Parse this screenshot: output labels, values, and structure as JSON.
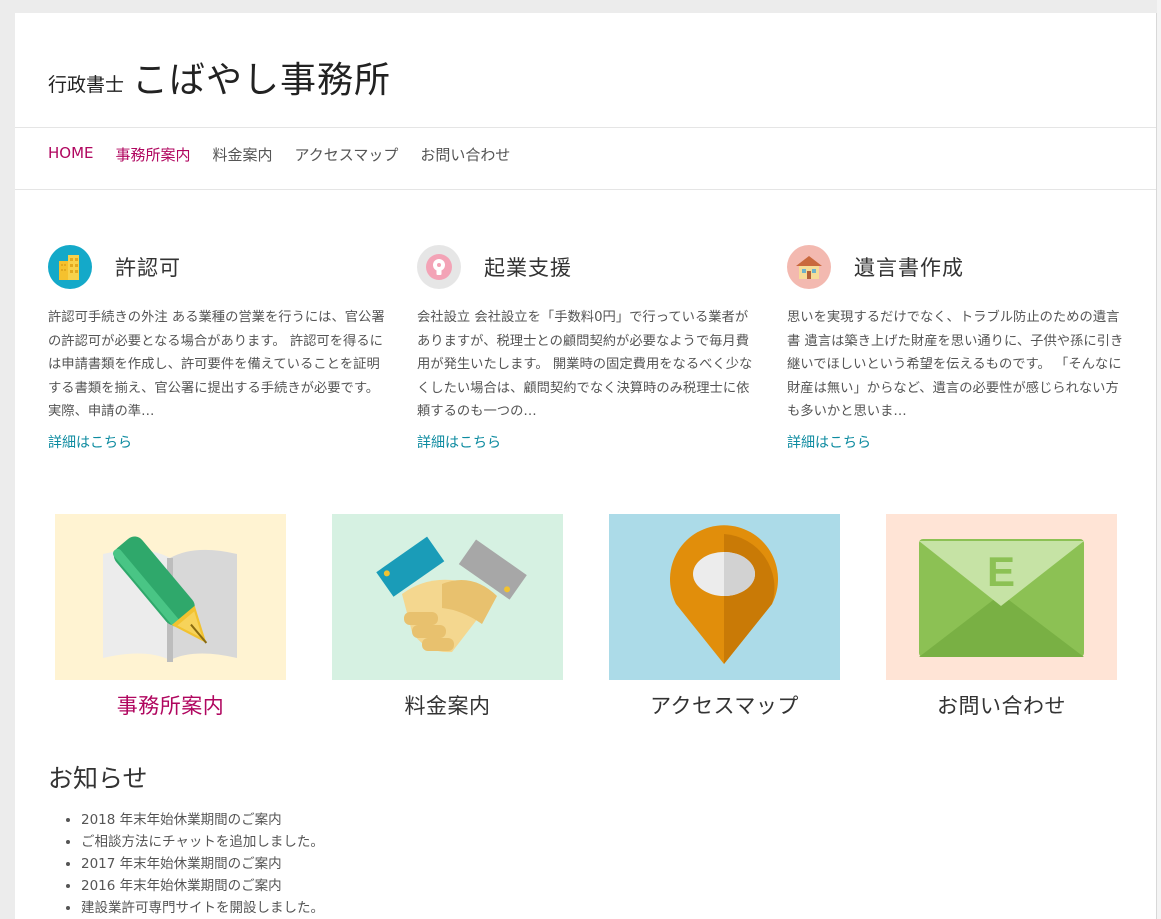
{
  "header": {
    "title_prefix": "行政書士",
    "title_main": "こばやし事務所"
  },
  "nav": [
    {
      "label": "HOME",
      "active": true
    },
    {
      "label": "事務所案内",
      "active": true
    },
    {
      "label": "料金案内",
      "active": false
    },
    {
      "label": "アクセスマップ",
      "active": false
    },
    {
      "label": "お問い合わせ",
      "active": false
    }
  ],
  "features": [
    {
      "icon": "building-icon",
      "title": "許認可",
      "text": "許認可手続きの外注 ある業種の営業を行うには、官公署の許認可が必要となる場合があります。 許認可を得るには申請書類を作成し、許可要件を備えていることを証明する書類を揃え、官公署に提出する手続きが必要です。 実際、申請の準…",
      "link": "詳細はこちら"
    },
    {
      "icon": "lightbulb-icon",
      "title": "起業支援",
      "text": "会社設立 会社設立を「手数料0円」で行っている業者がありますが、税理士との顧問契約が必要なようで毎月費用が発生いたします。 開業時の固定費用をなるべく少なくしたい場合は、顧問契約でなく決算時のみ税理士に依頼するのも一つの…",
      "link": "詳細はこちら"
    },
    {
      "icon": "house-icon",
      "title": "遺言書作成",
      "text": "思いを実現するだけでなく、トラブル防止のための遺言書 遺言は築き上げた財産を思い通りに、子供や孫に引き継いでほしいという希望を伝えるものです。 「そんなに財産は無い」からなど、遺言の必要性が感じられない方も多いかと思いま…",
      "link": "詳細はこちら"
    }
  ],
  "cards": [
    {
      "icon": "pen-book-icon",
      "label": "事務所案内",
      "bg": "#fff3d2",
      "active": true
    },
    {
      "icon": "handshake-icon",
      "label": "料金案内",
      "bg": "#d6f1e2",
      "active": false
    },
    {
      "icon": "map-pin-icon",
      "label": "アクセスマップ",
      "bg": "#acdbe8",
      "active": false
    },
    {
      "icon": "envelope-icon",
      "label": "お問い合わせ",
      "bg": "#ffe4d6",
      "active": false
    }
  ],
  "news": {
    "title": "お知らせ",
    "items": [
      "2018 年末年始休業期間のご案内",
      "ご相談方法にチャットを追加しました。",
      "2017 年末年始休業期間のご案内",
      "2016 年末年始休業期間のご案内",
      "建設業許可専門サイトを開設しました。"
    ]
  },
  "colors": {
    "accent": "#b0065f",
    "link": "#0d8ba0"
  }
}
